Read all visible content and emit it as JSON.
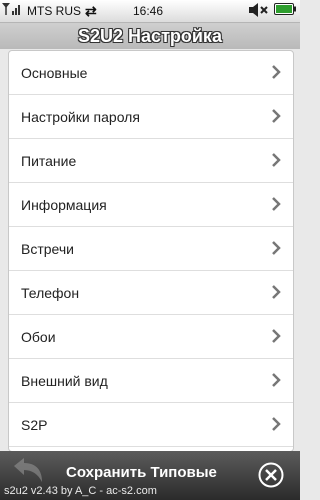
{
  "status_bar": {
    "carrier": "MTS RUS",
    "time": "16:46",
    "icons": [
      "signal-antenna-icon",
      "data-transfer-icon",
      "volume-muted-icon",
      "battery-icon"
    ]
  },
  "header": {
    "title": "S2U2 Настройка"
  },
  "menu": {
    "items": [
      {
        "label": "Основные"
      },
      {
        "label": "Настройки пароля"
      },
      {
        "label": "Питание"
      },
      {
        "label": "Информация"
      },
      {
        "label": "Встречи"
      },
      {
        "label": "Телефон"
      },
      {
        "label": "Обои"
      },
      {
        "label": "Внешний вид"
      },
      {
        "label": "S2P"
      }
    ],
    "chevron_icon": "chevron-right-icon"
  },
  "bottom_bar": {
    "save_label": "Сохранить Типовые",
    "back_icon": "back-arrow-icon",
    "close_icon": "close-icon",
    "version_text": "s2u2 v2.43 by A_C - ac-s2.com"
  },
  "colors": {
    "title_text": "#ffffff",
    "bottom_bar": "#3a3a3a",
    "battery_green": "#2e9e2e"
  }
}
